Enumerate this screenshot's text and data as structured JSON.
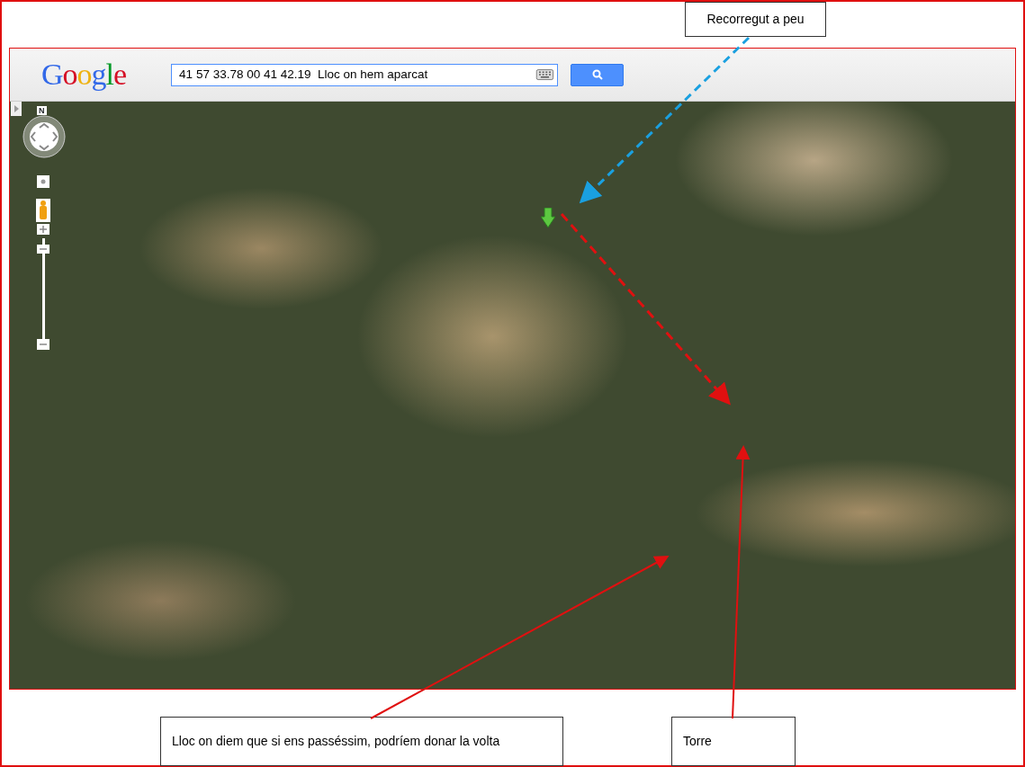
{
  "map_window": {
    "logo": "Google",
    "search": {
      "value": "41 57 33.78 00 41 42.19  Lloc on hem aparcat"
    },
    "controls": {
      "compass_label": "N"
    }
  },
  "callouts": [
    {
      "kind": "top",
      "text": "Recorregut a peu",
      "color": "#1aa0e0",
      "dashed": true
    },
    {
      "kind": "bottom-left",
      "text": "Lloc on diem que si ens passéssim, podríem donar la volta",
      "color": "#e01010",
      "dashed": false
    },
    {
      "kind": "bottom-right",
      "text": "Torre",
      "color": "#e01010",
      "dashed": false
    }
  ]
}
